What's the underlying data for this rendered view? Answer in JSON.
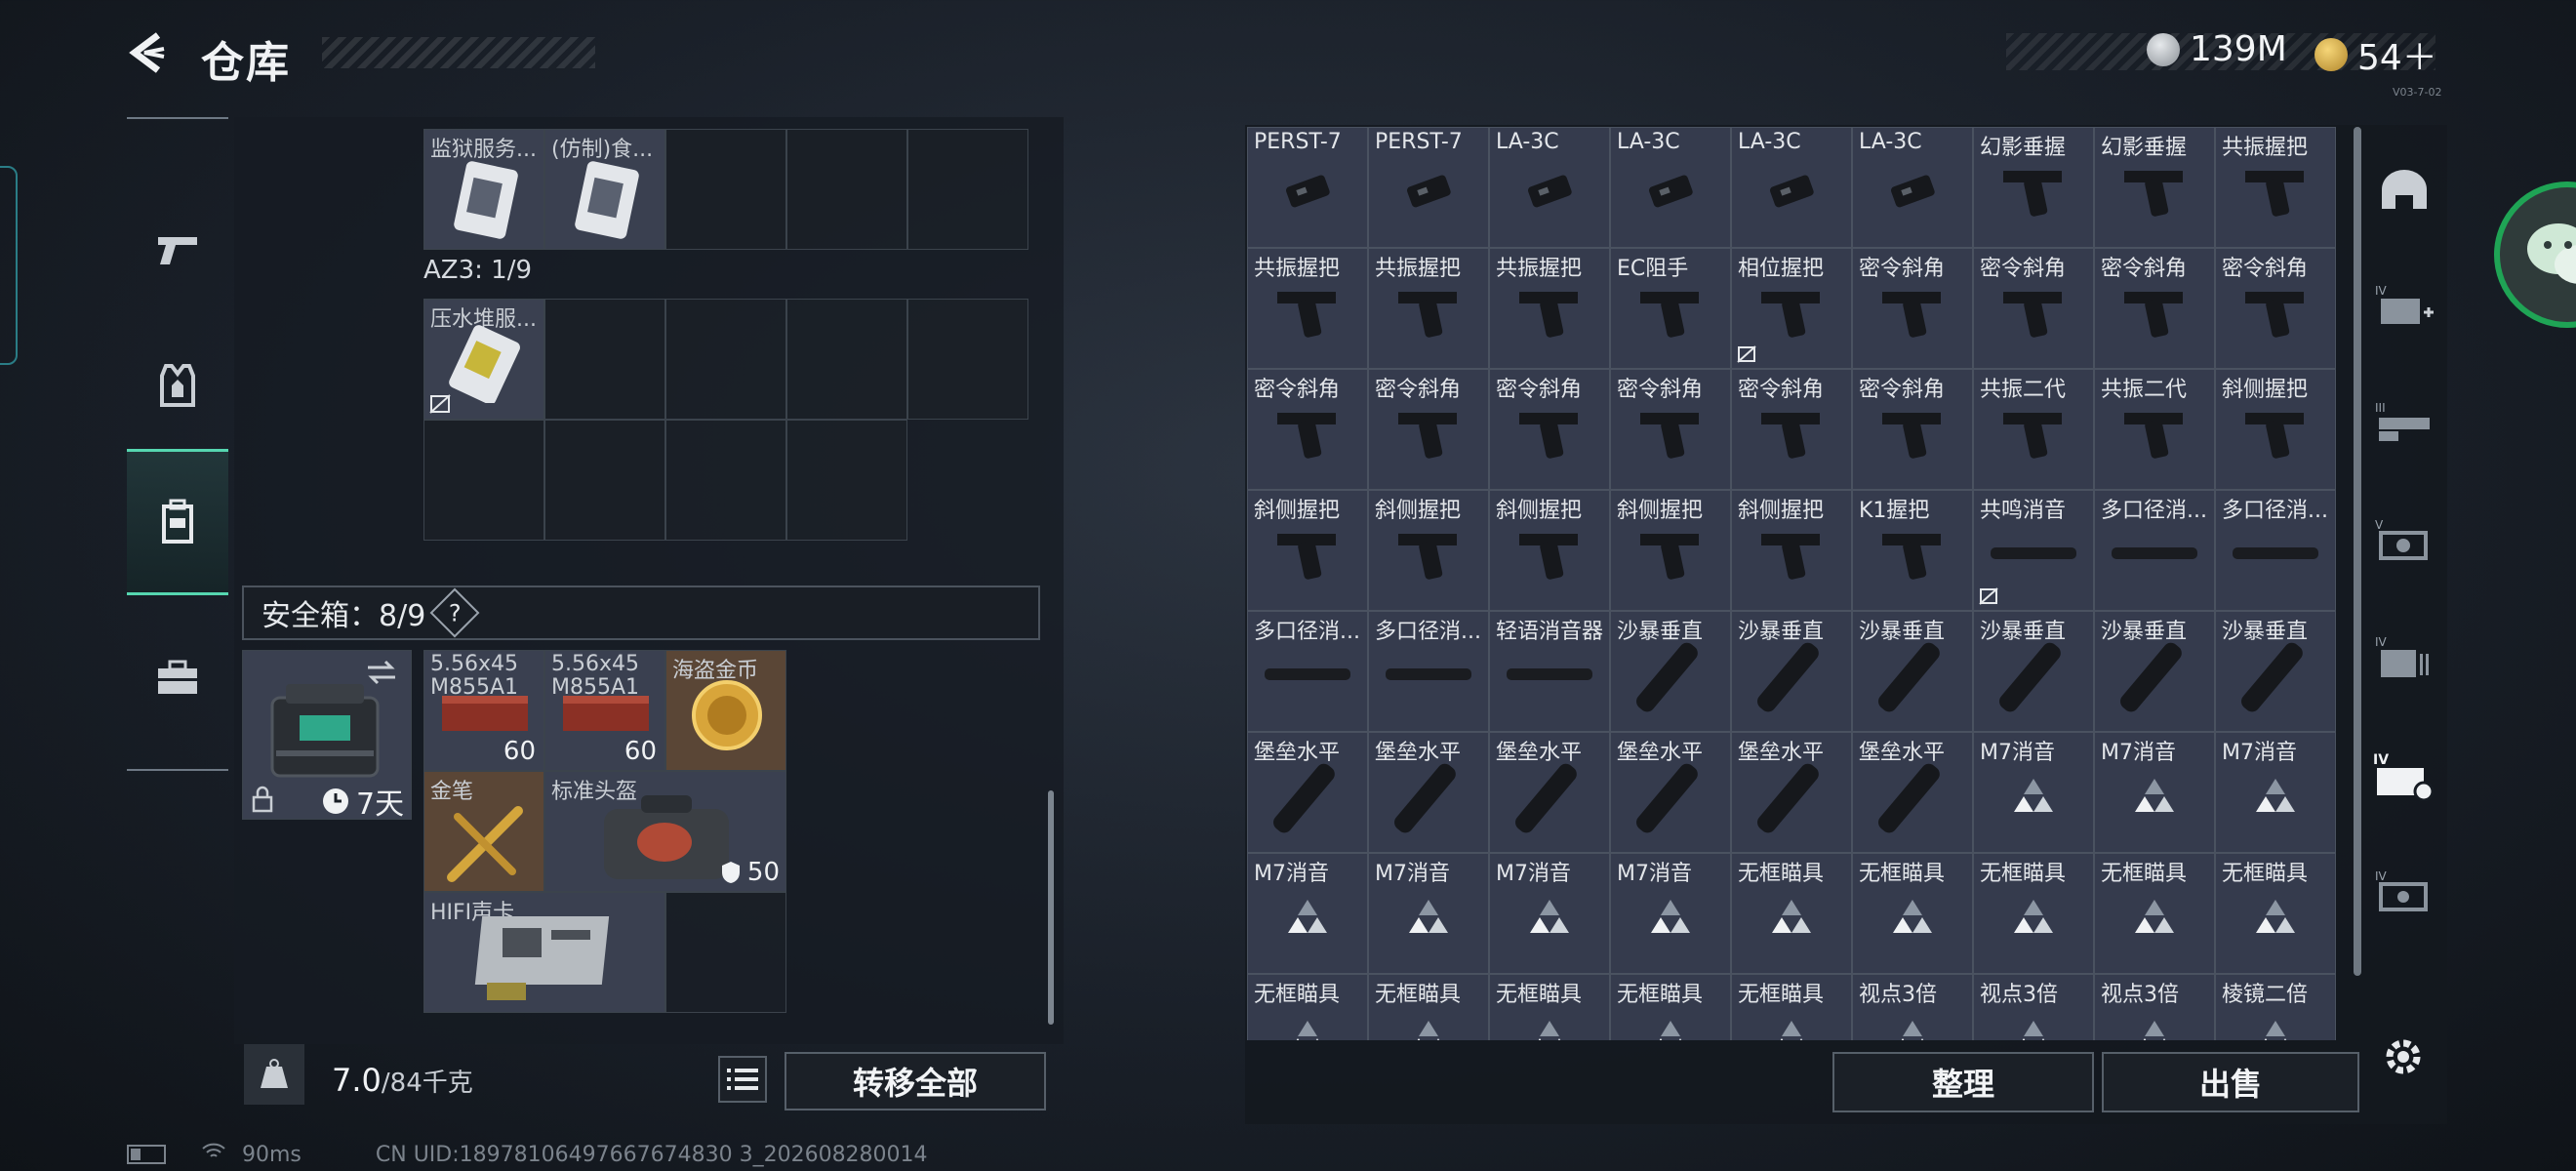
{
  "header": {
    "title": "仓库",
    "currency1": "139M",
    "currency2": "54＋",
    "version_tag": "V03-7-02"
  },
  "left_nav": [
    "weapon",
    "armor",
    "backpack",
    "case"
  ],
  "left_panel": {
    "top_items": [
      {
        "label": "监狱服务..."
      },
      {
        "label": "(仿制)食..."
      }
    ],
    "az3_label": "AZ3: 1/9",
    "az3_items": [
      {
        "label": "压水堆服..."
      }
    ],
    "safe_box_label": "安全箱：8/9",
    "safe_box_help": "?",
    "safe_items": [
      {
        "label": "5.56x45 M855A1",
        "count": "60"
      },
      {
        "label": "5.56x45 M855A1",
        "count": "60"
      },
      {
        "label": "海盗金币",
        "count": ""
      },
      {
        "label": "金笔",
        "count": ""
      },
      {
        "label": "标准头盔",
        "count": "50"
      },
      {
        "label": "HIFI声卡",
        "count": ""
      }
    ],
    "case_time": "7天",
    "weight": "7.0",
    "weight_max": "/84千克",
    "transfer_all": "转移全部"
  },
  "status_bar": {
    "ping": "90ms",
    "uid": "CN UID:18978106497667674830 3_202608280014"
  },
  "right_panel": {
    "items": [
      "PERST-7",
      "PERST-7",
      "LA-3C",
      "LA-3C",
      "LA-3C",
      "LA-3C",
      "幻影垂握",
      "幻影垂握",
      "共振握把",
      "共振握把",
      "共振握把",
      "共振握把",
      "EC阻手",
      "相位握把",
      "密令斜角",
      "密令斜角",
      "密令斜角",
      "密令斜角",
      "密令斜角",
      "密令斜角",
      "密令斜角",
      "密令斜角",
      "密令斜角",
      "密令斜角",
      "共振二代",
      "共振二代",
      "斜侧握把",
      "斜侧握把",
      "斜侧握把",
      "斜侧握把",
      "斜侧握把",
      "斜侧握把",
      "K1握把",
      "共鸣消音",
      "多口径消...",
      "多口径消...",
      "多口径消...",
      "多口径消...",
      "轻语消音器",
      "沙暴垂直",
      "沙暴垂直",
      "沙暴垂直",
      "沙暴垂直",
      "沙暴垂直",
      "沙暴垂直",
      "堡垒水平",
      "堡垒水平",
      "堡垒水平",
      "堡垒水平",
      "堡垒水平",
      "堡垒水平",
      "M7消音",
      "M7消音",
      "M7消音",
      "M7消音",
      "M7消音",
      "M7消音",
      "M7消音",
      "无框瞄具",
      "无框瞄具",
      "无框瞄具",
      "无框瞄具",
      "无框瞄具",
      "无框瞄具",
      "无框瞄具",
      "无框瞄具",
      "无框瞄具",
      "无框瞄具",
      "视点3倍",
      "视点3倍",
      "视点3倍",
      "棱镜二倍"
    ],
    "sort": "整理",
    "sell": "出售"
  },
  "right_nav": [
    "helmet-filter",
    "IV-add",
    "III",
    "V",
    "IV",
    "IV-active",
    "IV-2"
  ],
  "colors": {
    "accent": "#56d6b0",
    "cell_bg": "#353b4d",
    "panel_bg": "#161b22"
  }
}
